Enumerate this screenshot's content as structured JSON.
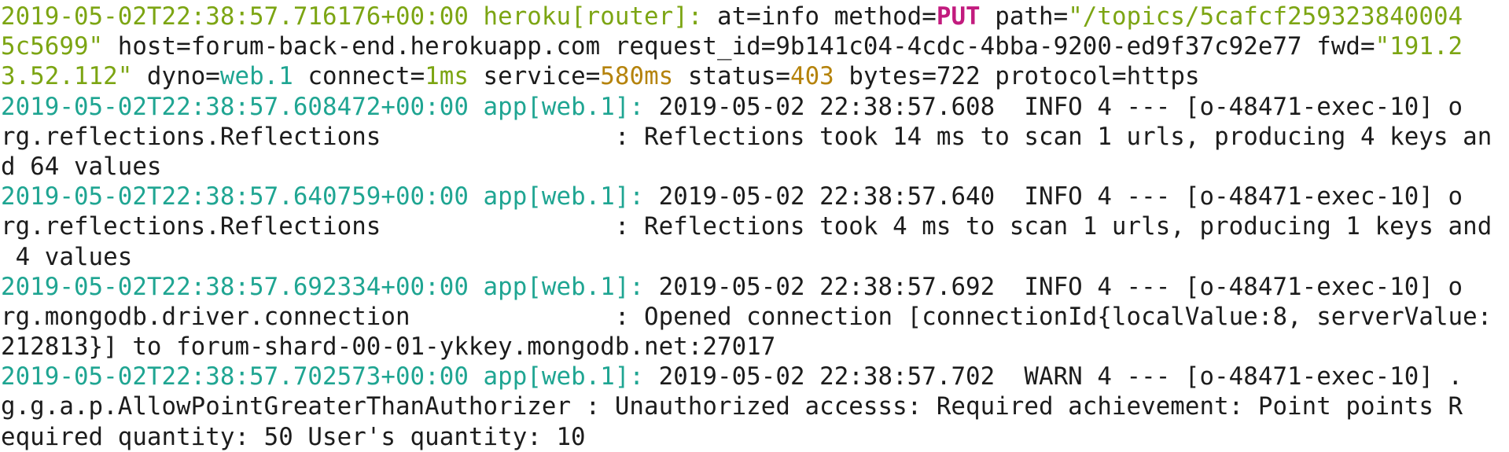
{
  "colors": {
    "background": "#ffffff",
    "text": "#1c1c1c",
    "router_timestamp": "#7ca513",
    "app_timestamp": "#1fa592",
    "method": "#c21b7e",
    "warning_value": "#b5830c"
  },
  "log": {
    "entry1": {
      "timestamp": "2019-05-02T22:38:57.716176+00:00",
      "source": "heroku[router]:",
      "l1_text": " at=info method=",
      "method": "PUT",
      "l1_path_key": " path=",
      "l1_path_val": "\"/topics/5cafcf259323840004",
      "l2_path_val": "5c5699\"",
      "l2_text": " host=forum-back-end.herokuapp.com request_id=9b141c04-4cdc-4bba-9200-ed9f37c92e77 fwd=",
      "l2_fwd_val": "\"191.2",
      "l3_fwd_val": "3.52.112\"",
      "l3_dyno_key": " dyno=",
      "l3_dyno_val": "web.1",
      "l3_connect_key": " connect=",
      "l3_connect_val": "1ms",
      "l3_service_key": " service=",
      "l3_service_val": "580ms",
      "l3_status_key": " status=",
      "l3_status_val": "403",
      "l3_rest": " bytes=722 protocol=https"
    },
    "entry2": {
      "timestamp": "2019-05-02T22:38:57.608472+00:00",
      "source": "app[web.1]:",
      "l1_text": " 2019-05-02 22:38:57.608  INFO 4 --- [o-48471-exec-10] o",
      "l2_text": "rg.reflections.Reflections                : Reflections took 14 ms to scan 1 urls, producing 4 keys an",
      "l3_text": "d 64 values"
    },
    "entry3": {
      "timestamp": "2019-05-02T22:38:57.640759+00:00",
      "source": "app[web.1]:",
      "l1_text": " 2019-05-02 22:38:57.640  INFO 4 --- [o-48471-exec-10] o",
      "l2_text": "rg.reflections.Reflections                : Reflections took 4 ms to scan 1 urls, producing 1 keys and",
      "l3_text": " 4 values"
    },
    "entry4": {
      "timestamp": "2019-05-02T22:38:57.692334+00:00",
      "source": "app[web.1]:",
      "l1_text": " 2019-05-02 22:38:57.692  INFO 4 --- [o-48471-exec-10] o",
      "l2_text": "rg.mongodb.driver.connection              : Opened connection [connectionId{localValue:8, serverValue:",
      "l3_text": "212813}] to forum-shard-00-01-ykkey.mongodb.net:27017"
    },
    "entry5": {
      "timestamp": "2019-05-02T22:38:57.702573+00:00",
      "source": "app[web.1]:",
      "l1_text": " 2019-05-02 22:38:57.702  WARN 4 --- [o-48471-exec-10] .",
      "l2_text": "g.g.a.p.AllowPointGreaterThanAuthorizer : Unauthorized accesss: Required achievement: Point points R",
      "l3_text": "equired quantity: 50 User's quantity: 10"
    }
  }
}
